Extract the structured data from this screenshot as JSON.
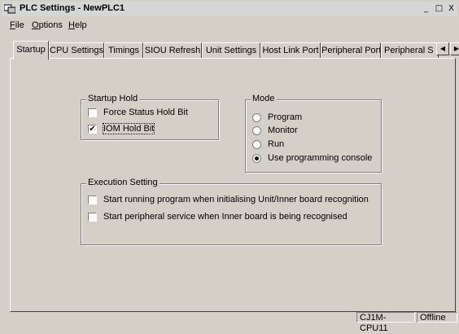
{
  "window": {
    "title": "PLC Settings - NewPLC1",
    "icons": {
      "app": "plc-app-icon",
      "minimize": "minimize-icon",
      "maximize": "maximize-icon",
      "close": "close-icon"
    },
    "minimize_glyph": "_",
    "maximize_glyph": "□",
    "close_glyph": "X"
  },
  "menu": [
    {
      "label": "File",
      "accel": "F",
      "rest": "ile"
    },
    {
      "label": "Options",
      "accel": "O",
      "rest": "ptions"
    },
    {
      "label": "Help",
      "accel": "H",
      "rest": "elp"
    }
  ],
  "tabs": [
    "Startup",
    "CPU Settings",
    "Timings",
    "SIOU Refresh",
    "Unit Settings",
    "Host Link Port",
    "Peripheral Port",
    "Peripheral S"
  ],
  "tab_scroll": {
    "left_glyph": "◀",
    "right_glyph": "▶"
  },
  "startup_hold": {
    "title": "Startup Hold",
    "options": [
      {
        "label": "Force Status Hold Bit",
        "checked": false
      },
      {
        "label": "IOM Hold Bit",
        "checked": true
      }
    ]
  },
  "mode": {
    "title": "Mode",
    "options": [
      {
        "label": "Program",
        "selected": false
      },
      {
        "label": "Monitor",
        "selected": false
      },
      {
        "label": "Run",
        "selected": false
      },
      {
        "label": "Use programming console",
        "selected": true
      }
    ]
  },
  "execution_setting": {
    "title": "Execution Setting",
    "options": [
      {
        "label": "Start running program when initialising Unit/Inner board recognition",
        "checked": false
      },
      {
        "label": "Start peripheral service when Inner board is being recognised",
        "checked": false
      }
    ]
  },
  "check_glyph": "✔",
  "status": {
    "cpu": "CJ1M-CPU11",
    "connection": "Offline"
  }
}
